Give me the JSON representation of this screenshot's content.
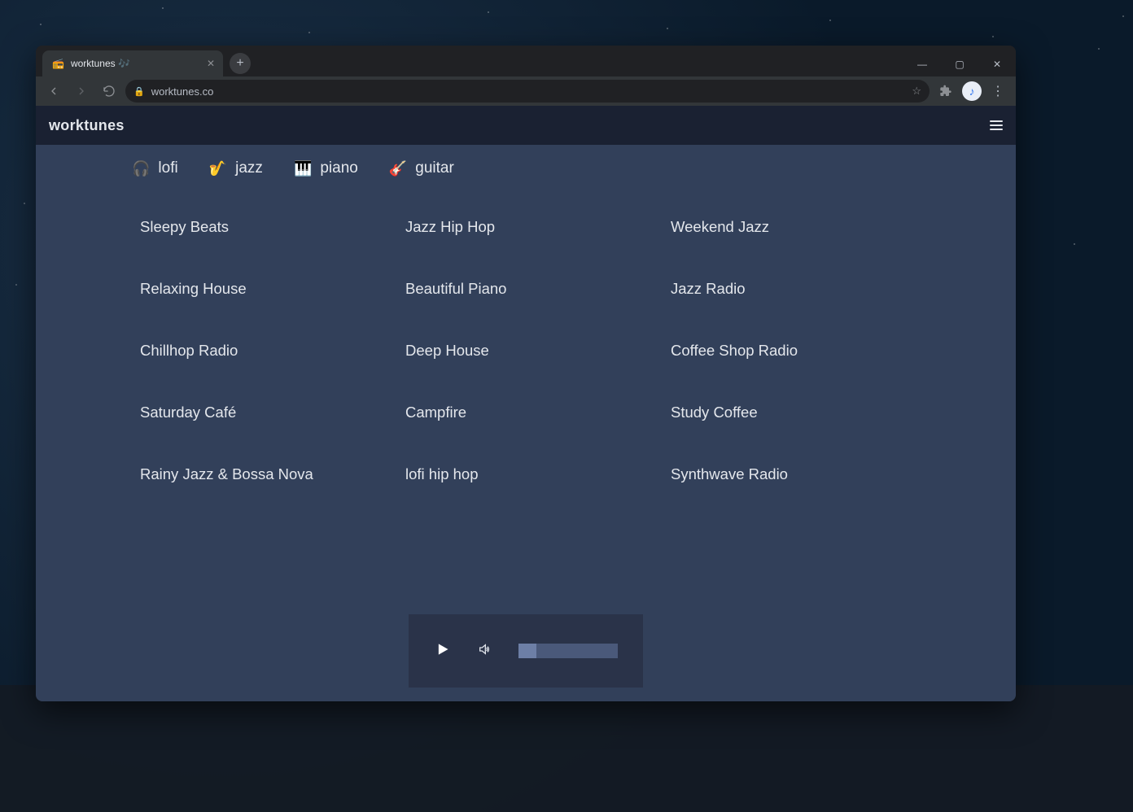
{
  "browser": {
    "tab_title": "worktunes 🎶",
    "url": "worktunes.co"
  },
  "brand": "worktunes",
  "filters": [
    {
      "emoji": "🎧",
      "label": "lofi"
    },
    {
      "emoji": "🎷",
      "label": "jazz"
    },
    {
      "emoji": "🎹",
      "label": "piano"
    },
    {
      "emoji": "🎸",
      "label": "guitar"
    }
  ],
  "stations": [
    "Sleepy Beats",
    "Jazz Hip Hop",
    "Weekend Jazz",
    "Relaxing House",
    "Beautiful Piano",
    "Jazz Radio",
    "Chillhop Radio",
    "Deep House",
    "Coffee Shop Radio",
    "Saturday Café",
    "Campfire",
    "Study Coffee",
    "Rainy Jazz & Bossa Nova",
    "lofi hip hop",
    "Synthwave Radio"
  ],
  "player": {
    "playing": false,
    "volume_percent": 18
  }
}
